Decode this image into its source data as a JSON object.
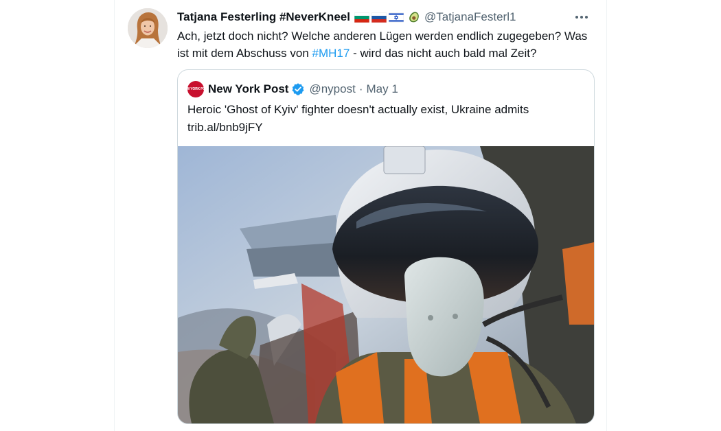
{
  "tweet": {
    "display_name": "Tatjana Festerling #NeverKneel",
    "flags": [
      "bulgaria-flag",
      "russia-flag",
      "israel-flag"
    ],
    "emoji": "avocado",
    "handle": "@TatjanaFesterl1",
    "text_part1": "Ach, jetzt doch nicht? Welche anderen Lügen werden endlich zugegeben? Was ist mit dem Abschuss von ",
    "hashtag": "#MH17",
    "text_part2": " - wird das nicht auch bald mal Zeit?"
  },
  "quoted_tweet": {
    "logo_text": "NEW YORK POST",
    "display_name": "New York Post",
    "handle": "@nypost",
    "separator": "·",
    "date": "May 1",
    "text_line1": "Heroic 'Ghost of Kyiv' fighter doesn't actually exist, Ukraine admits",
    "text_line2": "trib.al/bnb9jFY",
    "media_description_icon": "fighter-pilot-photo"
  },
  "colors": {
    "link": "#1d9bf0",
    "text": "#0f1419",
    "secondary": "#536471",
    "border": "#cfd9de",
    "nypost_red": "#c8102e"
  }
}
